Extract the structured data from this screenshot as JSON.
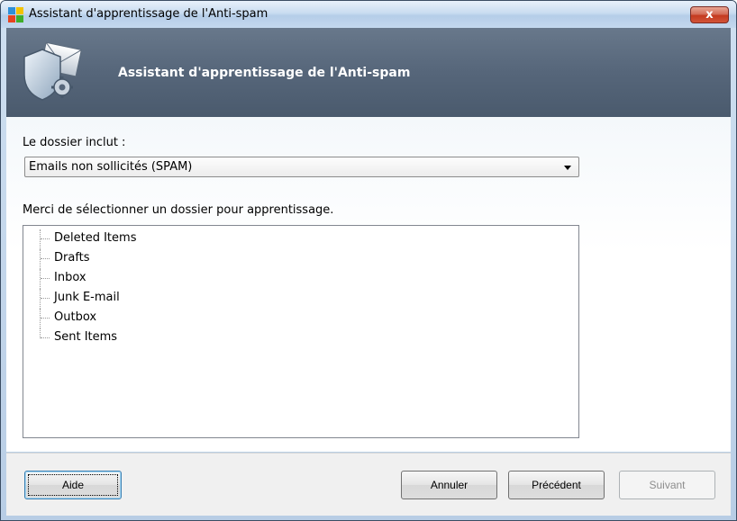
{
  "window": {
    "title": "Assistant d'apprentissage de l'Anti-spam",
    "close_label": "x"
  },
  "header": {
    "title": "Assistant d'apprentissage de l'Anti-spam"
  },
  "form": {
    "folder_label": "Le dossier inclut :",
    "folder_select_value": "Emails non sollicités (SPAM)",
    "instruction": "Merci de sélectionner un dossier pour apprentissage."
  },
  "tree": {
    "items": [
      {
        "label": "Deleted Items"
      },
      {
        "label": "Drafts"
      },
      {
        "label": "Inbox"
      },
      {
        "label": "Junk E-mail"
      },
      {
        "label": "Outbox"
      },
      {
        "label": "Sent Items"
      }
    ]
  },
  "buttons": {
    "help": "Aide",
    "cancel": "Annuler",
    "previous": "Précédent",
    "next": "Suivant"
  },
  "colors": {
    "header_bg": "#56667a",
    "close_red": "#c43a1f"
  },
  "icons": {
    "app": "avg-logo-icon",
    "header": "shield-envelope-gear-icon"
  }
}
